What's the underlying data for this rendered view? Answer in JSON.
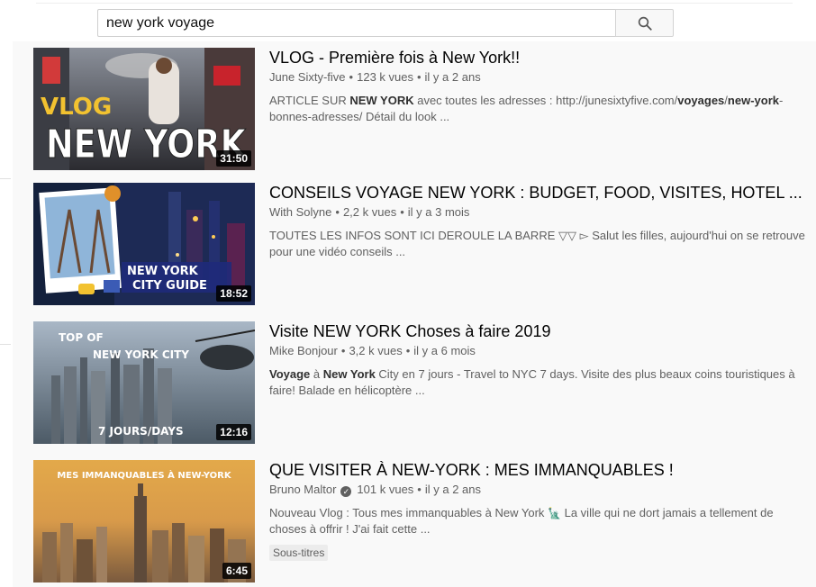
{
  "search": {
    "query": "new york voyage"
  },
  "videos": [
    {
      "title": "VLOG - Première fois à New York!!",
      "channel": "June Sixty-five",
      "views": "123 k vues",
      "age": "il y a 2 ans",
      "duration": "31:50",
      "desc_parts": [
        "ARTICLE SUR ",
        "NEW YORK",
        " avec toutes les adresses : http://junesixtyfive.com/",
        "voyages",
        "/",
        "new-york",
        "-bonnes-adresses/ Détail du look ..."
      ],
      "thumb_text": [
        "VLOG",
        "NEW YORK"
      ]
    },
    {
      "title": "CONSEILS VOYAGE NEW YORK : BUDGET, FOOD, VISITES, HOTEL ...",
      "channel": "With Solyne",
      "views": "2,2 k vues",
      "age": "il y a 3 mois",
      "duration": "18:52",
      "desc": "TOUTES LES INFOS SONT ICI DEROULE LA BARRE ▽▽ ▻ Salut les filles, aujourd'hui on se retrouve pour une vidéo conseils ...",
      "thumb_text": [
        "NEW YORK",
        "CITY GUIDE"
      ]
    },
    {
      "title": "Visite NEW YORK Choses à faire 2019",
      "channel": "Mike Bonjour",
      "views": "3,2 k vues",
      "age": "il y a 6 mois",
      "duration": "12:16",
      "desc_parts": [
        "Voyage",
        " à ",
        "New York",
        " City en 7 jours - Travel to NYC 7 days. Visite des plus beaux coins touristiques à faire! Balade en hélicoptère ..."
      ],
      "thumb_text": [
        "TOP OF",
        "NEW YORK CITY",
        "7 JOURS/DAYS"
      ]
    },
    {
      "title": "QUE VISITER À NEW-YORK : MES IMMANQUABLES !",
      "channel": "Bruno Maltor",
      "views": "101 k vues",
      "age": "il y a 2 ans",
      "duration": "6:45",
      "desc_before": "Nouveau Vlog : Tous mes immanquables à New York ",
      "desc_after": " La ville qui ne dort jamais a tellement de choses à offrir ! J'ai fait cette ...",
      "badge": "Sous-titres",
      "thumb_text": [
        "MES IMMANQUABLES À NEW-YORK"
      ]
    }
  ],
  "icons": {
    "search": "search-icon",
    "verified": "verified-check-icon",
    "statue": "statue-of-liberty-icon"
  }
}
